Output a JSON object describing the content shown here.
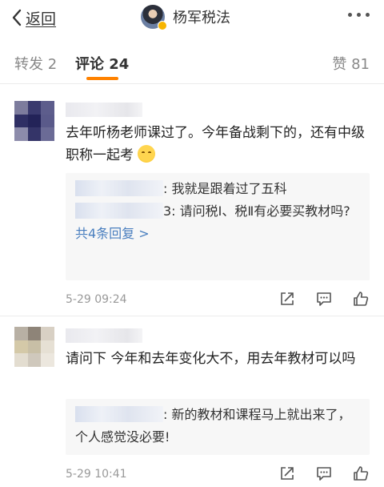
{
  "nav": {
    "back_label": "返回",
    "account_name": "杨军税法"
  },
  "tabs": {
    "repost": "转发 2",
    "comments": "评论 24",
    "likes": "赞 81"
  },
  "comments": [
    {
      "text": "去年听杨老师课过了。今年备战剩下的，还有中级职称一起考",
      "replies": [
        {
          "text": ": 我就是跟着过了五科"
        },
        {
          "text": "3: 请问税Ⅰ、税Ⅱ有必要买教材吗?"
        }
      ],
      "more_replies": "共4条回复 >",
      "timestamp": "5-29 09:24"
    },
    {
      "text": "请问下 今年和去年变化大不，用去年教材可以吗",
      "replies": [
        {
          "text": ": 新的教材和课程马上就出来了，个人感觉没必要!"
        }
      ],
      "timestamp": "5-29 10:41"
    }
  ],
  "colors": {
    "accent": "#ff8200",
    "link": "#4a7fbf",
    "verified_badge": "#f7b500"
  },
  "icons": [
    "chevron-left-icon",
    "more-dots-icon",
    "share-icon",
    "comment-icon",
    "like-icon",
    "smile-emoji"
  ]
}
